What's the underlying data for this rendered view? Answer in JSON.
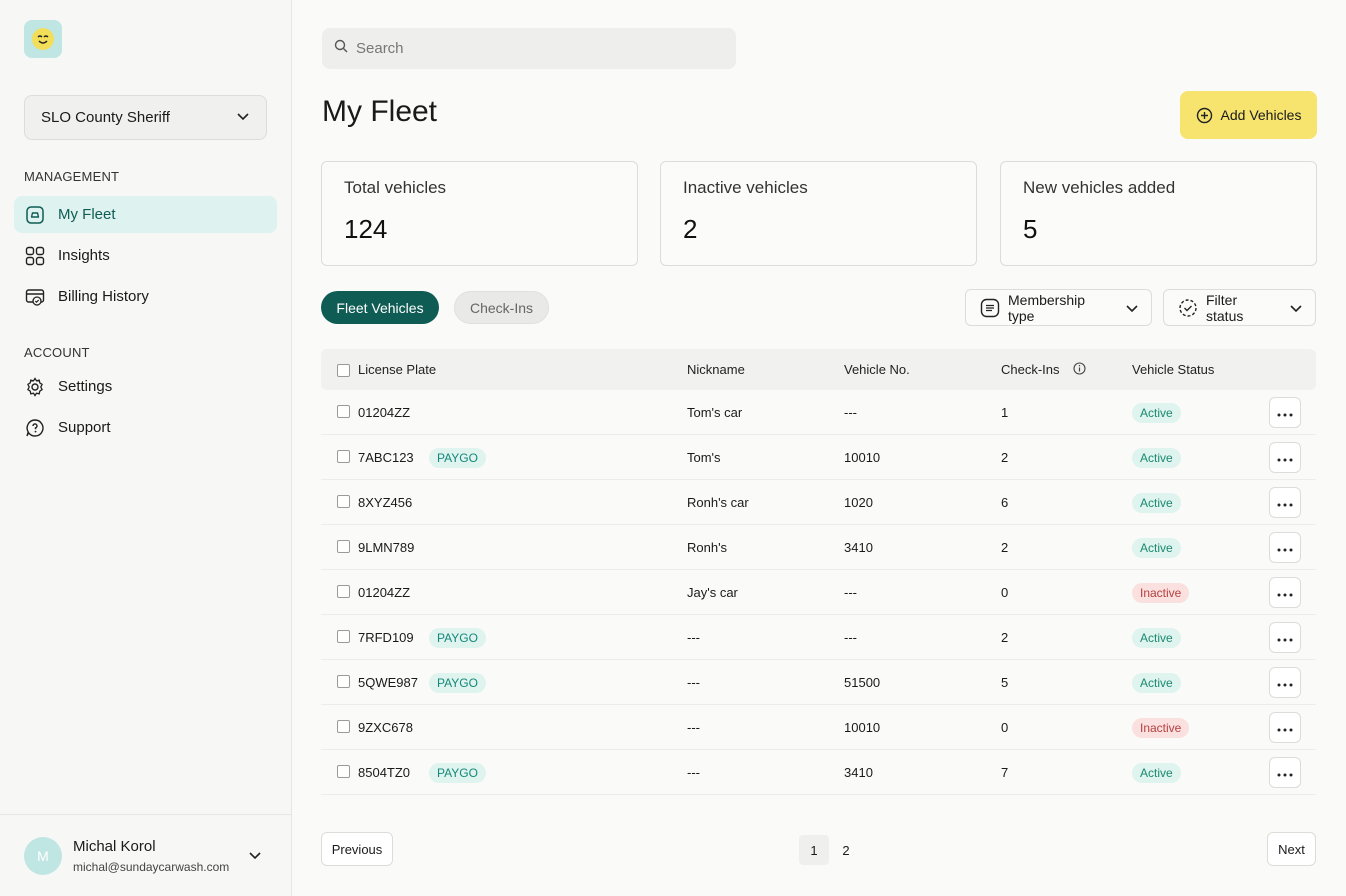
{
  "sidebar": {
    "org": "SLO County Sheriff",
    "sections": {
      "management": "MANAGEMENT",
      "account": "ACCOUNT"
    },
    "management_items": [
      {
        "label": "My Fleet",
        "icon": "car-icon",
        "active": true
      },
      {
        "label": "Insights",
        "icon": "grid-icon"
      },
      {
        "label": "Billing History",
        "icon": "billing-icon"
      }
    ],
    "account_items": [
      {
        "label": "Settings",
        "icon": "gear-icon"
      },
      {
        "label": "Support",
        "icon": "support-icon"
      }
    ],
    "user": {
      "initial": "M",
      "name": "Michal Korol",
      "email": "michal@sundaycarwash.com"
    }
  },
  "search": {
    "placeholder": "Search"
  },
  "page": {
    "title": "My Fleet",
    "add_button": "Add Vehicles"
  },
  "stats": [
    {
      "label": "Total vehicles",
      "value": "124"
    },
    {
      "label": "Inactive vehicles",
      "value": "2"
    },
    {
      "label": "New vehicles added",
      "value": "5"
    }
  ],
  "tabs": {
    "fleet": "Fleet Vehicles",
    "checkins": "Check-Ins"
  },
  "filters": {
    "membership": "Membership type",
    "status": "Filter status"
  },
  "table": {
    "headers": {
      "plate": "License Plate",
      "nickname": "Nickname",
      "vehicle_no": "Vehicle No.",
      "checkins": "Check-Ins",
      "status": "Vehicle Status"
    },
    "rows": [
      {
        "plate": "01204ZZ",
        "tag": "",
        "nickname": "Tom's car",
        "vehicle_no": "---",
        "checkins": "1",
        "status": "Active"
      },
      {
        "plate": "7ABC123",
        "tag": "PAYGO",
        "nickname": "Tom's",
        "vehicle_no": "10010",
        "checkins": "2",
        "status": "Active"
      },
      {
        "plate": "8XYZ456",
        "tag": "",
        "nickname": "Ronh's car",
        "vehicle_no": "1020",
        "checkins": "6",
        "status": "Active"
      },
      {
        "plate": "9LMN789",
        "tag": "",
        "nickname": "Ronh's",
        "vehicle_no": "3410",
        "checkins": "2",
        "status": "Active"
      },
      {
        "plate": "01204ZZ",
        "tag": "",
        "nickname": "Jay's car",
        "vehicle_no": "---",
        "checkins": "0",
        "status": "Inactive"
      },
      {
        "plate": "7RFD109",
        "tag": "PAYGO",
        "nickname": "---",
        "vehicle_no": "---",
        "checkins": "2",
        "status": "Active"
      },
      {
        "plate": "5QWE987",
        "tag": "PAYGO",
        "nickname": "---",
        "vehicle_no": "51500",
        "checkins": "5",
        "status": "Active"
      },
      {
        "plate": "9ZXC678",
        "tag": "",
        "nickname": "---",
        "vehicle_no": "10010",
        "checkins": "0",
        "status": "Inactive"
      },
      {
        "plate": "8504TZ0",
        "tag": "PAYGO",
        "nickname": "---",
        "vehicle_no": "3410",
        "checkins": "7",
        "status": "Active"
      }
    ]
  },
  "pagination": {
    "previous": "Previous",
    "next": "Next",
    "pages": [
      "1",
      "2"
    ],
    "current": "1"
  },
  "colors": {
    "accent": "#0f5c55",
    "cta": "#f6e46f",
    "active_bg": "#dff3ef",
    "inactive_bg": "#fbe0e0"
  }
}
